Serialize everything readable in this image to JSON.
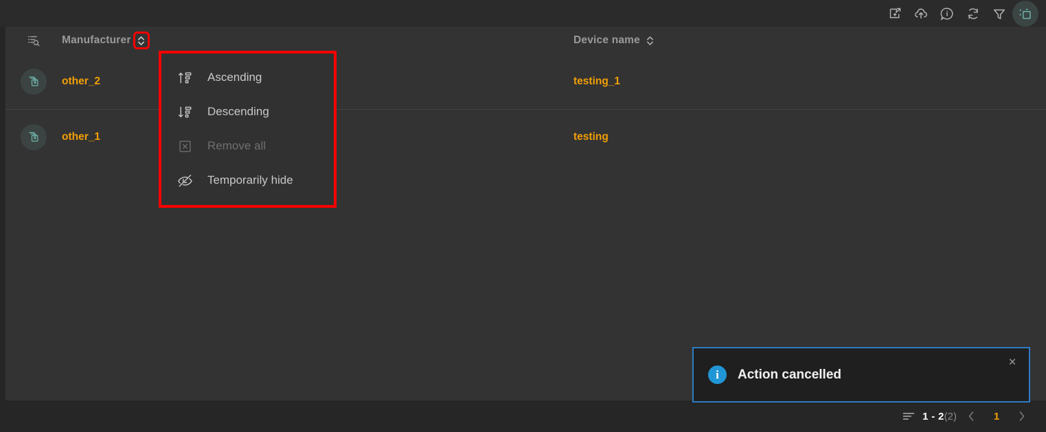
{
  "toolbar": {
    "icons": [
      {
        "name": "export-window-icon",
        "title": "Open in new window"
      },
      {
        "name": "cloud-upload-icon",
        "title": "Upload"
      },
      {
        "name": "info-circle-icon",
        "title": "Information"
      },
      {
        "name": "refresh-icon",
        "title": "Refresh"
      },
      {
        "name": "filter-funnel-icon",
        "title": "Filter"
      },
      {
        "name": "multi-select-icon",
        "title": "Select mode"
      }
    ]
  },
  "table": {
    "tool_icon": "list-search-icon",
    "columns": [
      {
        "key": "manufacturer",
        "label": "Manufacturer",
        "sort_icon": "sort-updown-icon",
        "sort_highlighted": true
      },
      {
        "key": "device_name",
        "label": "Device name",
        "sort_icon": "sort-updown-icon",
        "sort_highlighted": false
      }
    ],
    "rows": [
      {
        "icon": "device-stack-icon",
        "manufacturer": "other_2",
        "device_name": "testing_1"
      },
      {
        "icon": "device-stack-icon",
        "manufacturer": "other_1",
        "device_name": "testing"
      }
    ]
  },
  "context_menu": {
    "items": [
      {
        "icon": "sort-ascending-icon",
        "label": "Ascending",
        "disabled": false
      },
      {
        "icon": "sort-descending-icon",
        "label": "Descending",
        "disabled": false
      },
      {
        "icon": "remove-box-icon",
        "label": "Remove all",
        "disabled": true
      },
      {
        "icon": "eye-off-icon",
        "label": "Temporarily hide",
        "disabled": false
      }
    ],
    "highlight_color": "#ff0000"
  },
  "toast": {
    "icon": "info-circle-filled-icon",
    "message": "Action cancelled",
    "close_label": "×",
    "border_color": "#2f7cc4",
    "icon_color": "#2196d6"
  },
  "footer": {
    "rows_icon": "rows-per-page-icon",
    "range": "1 - 2",
    "total": "(2)",
    "prev_label": "‹",
    "current_page": "1",
    "next_label": "›",
    "accent_color": "#f29f05"
  }
}
